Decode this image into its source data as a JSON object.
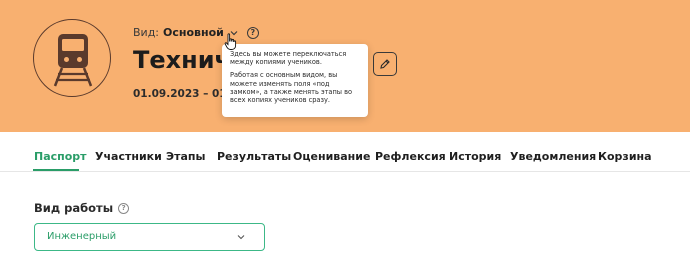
{
  "header": {
    "view_label": "Вид:",
    "view_value": "Основной",
    "title": "Техничес",
    "dates": "01.09.2023 – 01.03",
    "help_glyph": "?",
    "background_color": "#f8b070"
  },
  "tooltip": {
    "paragraph1": "Здесь вы можете переключаться между копиями учеников.",
    "paragraph2": "Работая с основным видом, вы можете изменять поля «под замком», а также менять этапы во всех копиях учеников сразу."
  },
  "tabs": [
    {
      "label": "Паспорт",
      "active": true
    },
    {
      "label": "Участники",
      "active": false
    },
    {
      "label": "Этапы",
      "active": false
    },
    {
      "label": "Результаты",
      "active": false
    },
    {
      "label": "Оценивание",
      "active": false
    },
    {
      "label": "Рефлексия",
      "active": false
    },
    {
      "label": "История",
      "active": false
    },
    {
      "label": "Уведомления",
      "active": false
    },
    {
      "label": "Корзина",
      "active": false
    }
  ],
  "work_type": {
    "label": "Вид работы",
    "help_glyph": "?",
    "selected_value": "Инженерный"
  },
  "colors": {
    "accent": "#2a9d68",
    "icon_dark": "#5a3a2c"
  },
  "icons": [
    "train-icon",
    "chevron-down-icon",
    "help-icon",
    "pencil-icon",
    "cursor-hand-icon"
  ]
}
